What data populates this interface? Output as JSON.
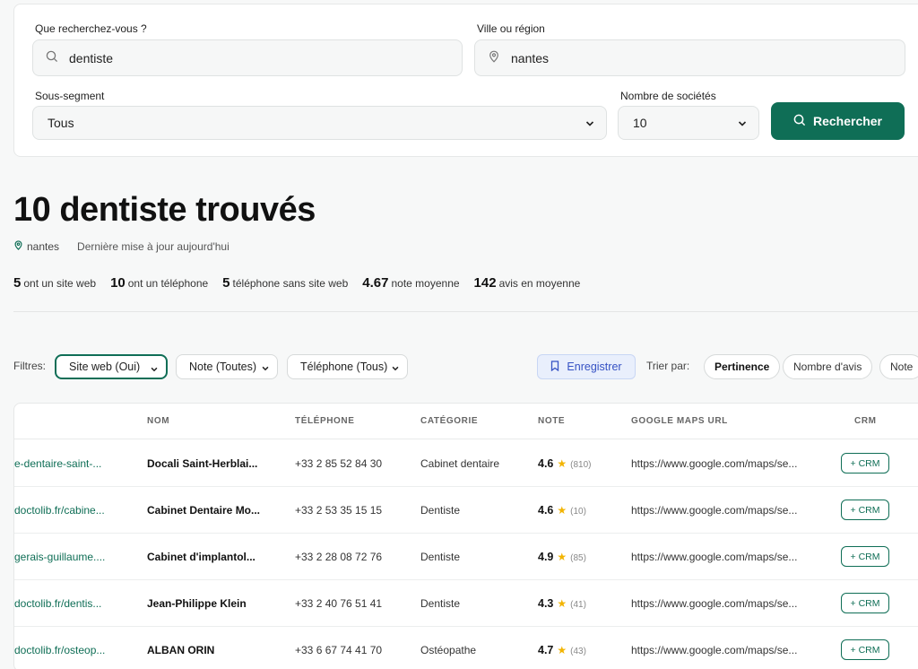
{
  "search": {
    "query_label": "Que recherchez-vous ?",
    "query_value": "dentiste",
    "location_label": "Ville ou région",
    "location_value": "nantes",
    "subsegment_label": "Sous-segment",
    "subsegment_value": "Tous",
    "count_label": "Nombre de sociétés",
    "count_value": "10",
    "search_button": "Rechercher"
  },
  "results": {
    "count": "10",
    "title_rest": "dentiste trouvés",
    "location": "nantes",
    "updated": "Dernière mise à jour aujourd'hui"
  },
  "stats": [
    {
      "value": "5",
      "label": "ont un site web"
    },
    {
      "value": "10",
      "label": "ont un téléphone"
    },
    {
      "value": "5",
      "label": "téléphone sans site web"
    },
    {
      "value": "4.67",
      "label": "note moyenne"
    },
    {
      "value": "142",
      "label": "avis en moyenne"
    }
  ],
  "filters": {
    "label": "Filtres:",
    "website": "Site web (Oui)",
    "rating": "Note (Toutes)",
    "phone": "Téléphone (Tous)",
    "save": "Enregistrer",
    "sort_label": "Trier par:",
    "sort_options": [
      "Pertinence",
      "Nombre d'avis",
      "Note"
    ]
  },
  "table": {
    "headers": {
      "name": "NOM",
      "phone": "TÉLÉPHONE",
      "category": "CATÉGORIE",
      "rating": "NOTE",
      "maps": "GOOGLE MAPS URL",
      "crm": "CRM"
    },
    "rows": [
      {
        "website": "e-dentaire-saint-...",
        "name": "Docali Saint-Herblai...",
        "phone": "+33 2 85 52 84 30",
        "category": "Cabinet dentaire",
        "rating": "4.6",
        "reviews": "(810)",
        "maps": "https://www.google.com/maps/se...",
        "crm": "+ CRM"
      },
      {
        "website": "doctolib.fr/cabine...",
        "name": "Cabinet Dentaire Mo...",
        "phone": "+33 2 53 35 15 15",
        "category": "Dentiste",
        "rating": "4.6",
        "reviews": "(10)",
        "maps": "https://www.google.com/maps/se...",
        "crm": "+ CRM"
      },
      {
        "website": "gerais-guillaume....",
        "name": "Cabinet d'implantol...",
        "phone": "+33 2 28 08 72 76",
        "category": "Dentiste",
        "rating": "4.9",
        "reviews": "(85)",
        "maps": "https://www.google.com/maps/se...",
        "crm": "+ CRM"
      },
      {
        "website": "doctolib.fr/dentis...",
        "name": "Jean-Philippe Klein",
        "phone": "+33 2 40 76 51 41",
        "category": "Dentiste",
        "rating": "4.3",
        "reviews": "(41)",
        "maps": "https://www.google.com/maps/se...",
        "crm": "+ CRM"
      },
      {
        "website": "doctolib.fr/osteop...",
        "name": "ALBAN ORIN",
        "phone": "+33 6 67 74 41 70",
        "category": "Ostéopathe",
        "rating": "4.7",
        "reviews": "(43)",
        "maps": "https://www.google.com/maps/se...",
        "crm": "+ CRM"
      }
    ]
  },
  "icons": {
    "search": "search-icon",
    "location": "map-pin-icon",
    "bookmark": "bookmark-icon",
    "chevron": "chevron-down-icon",
    "star": "star-icon"
  },
  "colors": {
    "accent": "#0f6e56",
    "save_blue": "#3652c4",
    "star": "#f2b400"
  }
}
